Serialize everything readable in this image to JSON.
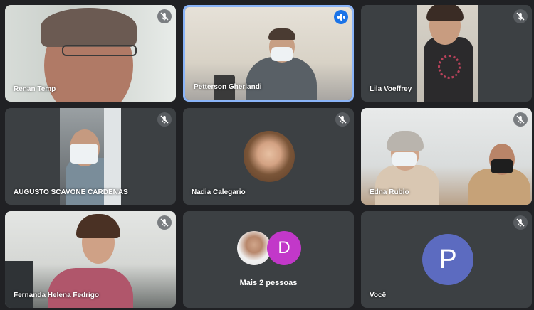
{
  "participants": [
    {
      "name": "Renan Temp",
      "muted": true
    },
    {
      "name": "Petterson Gherlandi",
      "muted": false,
      "speaking": true
    },
    {
      "name": "Lila Voeffrey",
      "muted": true
    },
    {
      "name": "AUGUSTO SCAVONE CARDENAS",
      "muted": true
    },
    {
      "name": "Nadia Calegario",
      "muted": true
    },
    {
      "name": "Edna Rubio",
      "muted": true
    },
    {
      "name": "Fernanda Helena Fedrigo",
      "muted": true
    },
    {
      "name": "Você",
      "muted": true,
      "avatar_letter": "P",
      "avatar_color": "#5c6bc0"
    }
  ],
  "others": {
    "label": "Mais 2 pessoas",
    "avatar_letter": "D",
    "avatar_color": "#c238c9"
  },
  "colors": {
    "background": "#202124",
    "tile": "#3c4043",
    "speaking_border": "#8ab4f8",
    "speaking_icon": "#1a73e8"
  },
  "icons": {
    "muted": "mic-off-icon",
    "speaking": "audio-level-icon"
  }
}
